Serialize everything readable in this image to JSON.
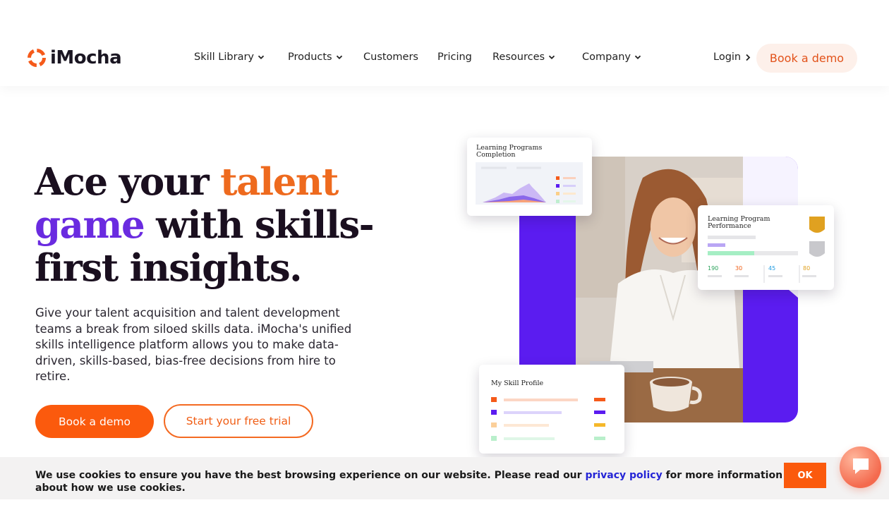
{
  "brand": {
    "name": "iMocha",
    "accent": "#fb5a0d",
    "purple": "#5b1cf0"
  },
  "nav": {
    "items": [
      {
        "label": "Skill Library",
        "dropdown": true
      },
      {
        "label": "Products",
        "dropdown": true
      },
      {
        "label": "Customers",
        "dropdown": false
      },
      {
        "label": "Pricing",
        "dropdown": false
      },
      {
        "label": "Resources",
        "dropdown": true
      },
      {
        "label": "Company",
        "dropdown": true
      }
    ],
    "login_label": "Login",
    "cta_label": "Book a demo"
  },
  "hero": {
    "headline": {
      "part1": "Ace your ",
      "part2": "talent",
      "part3": "game",
      "part4": " with skills-",
      "part5": "first insights."
    },
    "subtext": "Give your talent acquisition and talent development teams a break from siloed skills data. iMocha's unified skills intelligence platform allows you to make data-driven, skills-based, bias-free decisions from hire to retire.",
    "primary_cta": "Book a demo",
    "secondary_cta": "Start your free trial"
  },
  "visual": {
    "card_completion_title": "Learning Programs Completion",
    "card_performance_title": "Learning Program Performance",
    "card_performance_stats": [
      "190",
      "30",
      "45",
      "80"
    ],
    "card_skill_title": "My Skill Profile"
  },
  "cookie": {
    "text_before": "We use cookies to ensure you have the best browsing experience on our website. Please read our ",
    "link_label": "privacy policy",
    "text_after": " for more information about how we use cookies.",
    "ok_label": "OK"
  }
}
